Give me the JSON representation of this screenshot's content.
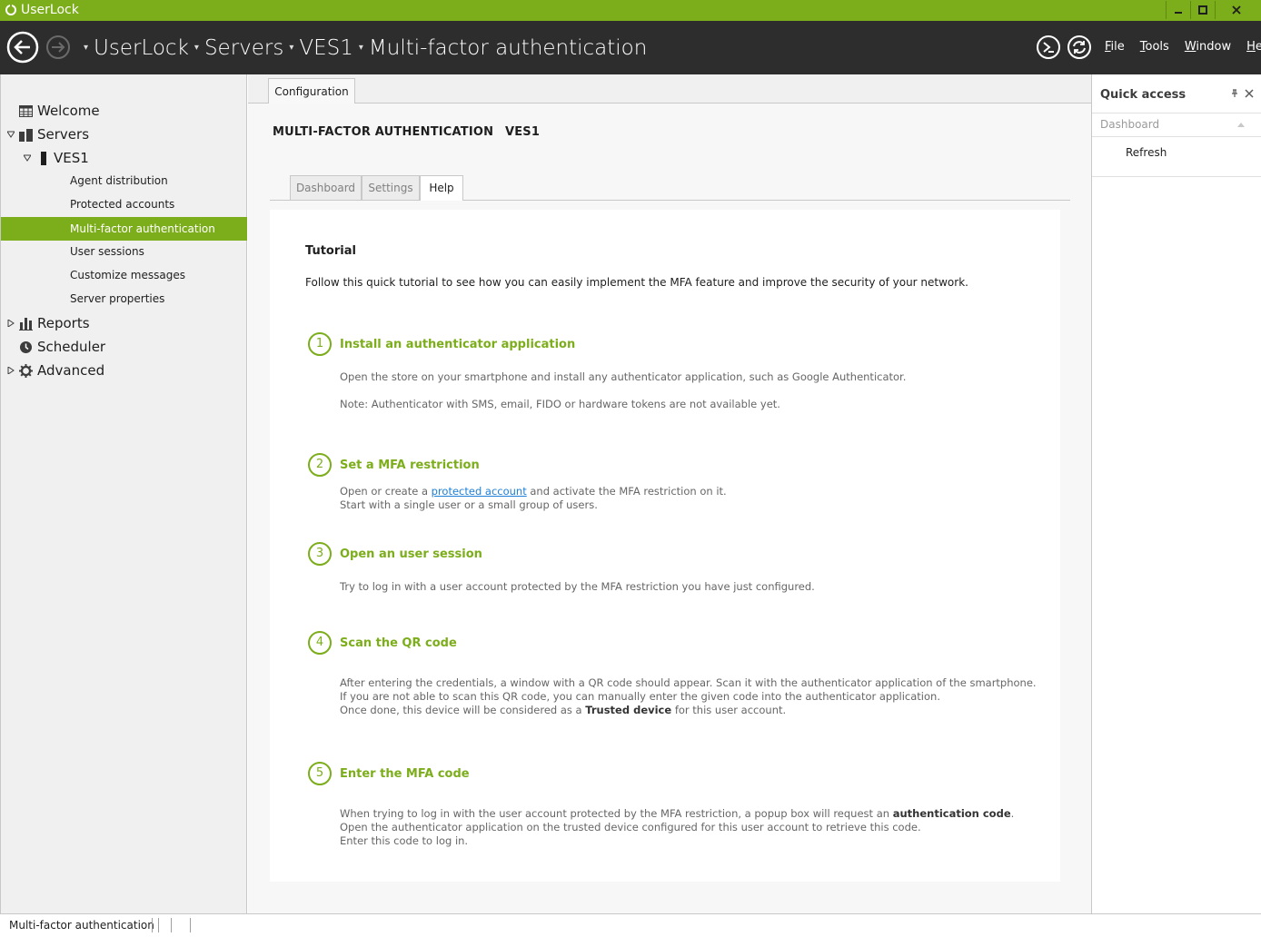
{
  "window": {
    "title": "UserLock",
    "colors": {
      "accent": "#7cad1a",
      "header_bg": "#2d2d2d"
    }
  },
  "header": {
    "breadcrumb": [
      "UserLock",
      "Servers",
      "VES1",
      "Multi-factor authentication"
    ],
    "menus": [
      {
        "label": "File",
        "access_key": "F"
      },
      {
        "label": "Tools",
        "access_key": "T"
      },
      {
        "label": "Window",
        "access_key": "W"
      },
      {
        "label": "Help",
        "access_key": "H"
      }
    ],
    "icons": [
      "back-icon",
      "forward-icon",
      "powershell-icon",
      "refresh-icon"
    ]
  },
  "sidebar": {
    "items": [
      {
        "label": "Welcome",
        "icon": "grid-icon"
      },
      {
        "label": "Servers",
        "icon": "servers-icon",
        "expanded": true
      },
      {
        "label": "VES1",
        "icon": "server-icon",
        "expanded": true
      },
      {
        "label": "Agent distribution"
      },
      {
        "label": "Protected accounts"
      },
      {
        "label": "Multi-factor authentication",
        "selected": true
      },
      {
        "label": "User sessions"
      },
      {
        "label": "Customize messages"
      },
      {
        "label": "Server properties"
      },
      {
        "label": "Reports",
        "icon": "chart-icon",
        "expanded": false
      },
      {
        "label": "Scheduler",
        "icon": "clock-icon"
      },
      {
        "label": "Advanced",
        "icon": "gear-icon",
        "expanded": false
      }
    ]
  },
  "main": {
    "tab": "Configuration",
    "title_prefix": "MULTI-FACTOR AUTHENTICATION",
    "title_server": "VES1",
    "subtabs": [
      "Dashboard",
      "Settings",
      "Help"
    ],
    "active_subtab": "Help",
    "tutorial": {
      "title": "Tutorial",
      "intro": "Follow this quick tutorial to see how you can easily implement the MFA feature and improve the security of your network.",
      "steps": [
        {
          "number": "1",
          "title": "Install an authenticator application",
          "lines": [
            "Open the store on your smartphone and install any authenticator application, such as Google Authenticator.",
            "Note: Authenticator with SMS, email, FIDO or hardware tokens are not available yet."
          ]
        },
        {
          "number": "2",
          "title": "Set a MFA restriction",
          "line1_before": "Open or create a ",
          "line1_link": "protected account",
          "line1_after": " and activate the MFA restriction on it.",
          "line2": "Start with a single user or a small group of users."
        },
        {
          "number": "3",
          "title": "Open an user session",
          "lines": [
            "Try to log in with a user account protected by the MFA restriction you have just configured."
          ]
        },
        {
          "number": "4",
          "title": "Scan the QR code",
          "line1": "After entering the credentials, a window with a QR code should appear. Scan it with the authenticator application of the smartphone.",
          "line2": "If you are not able to scan this QR code, you can manually enter the given code into the authenticator application.",
          "line3_before": "Once done, this device will be considered as a ",
          "line3_bold": "Trusted device",
          "line3_after": " for this user account."
        },
        {
          "number": "5",
          "title": "Enter the MFA code",
          "line1_before": "When trying to log in with the user account protected by the MFA restriction, a popup box will request an ",
          "line1_bold": "authentication code",
          "line1_after": ".",
          "line2": "Open the authenticator application on the trusted device configured for this user account to retrieve this code.",
          "line3": "Enter this code to log in."
        }
      ]
    }
  },
  "quick_access": {
    "title": "Quick access",
    "section": "Dashboard",
    "items": [
      "Refresh"
    ]
  },
  "status_bar": {
    "text": "Multi-factor authentication"
  }
}
